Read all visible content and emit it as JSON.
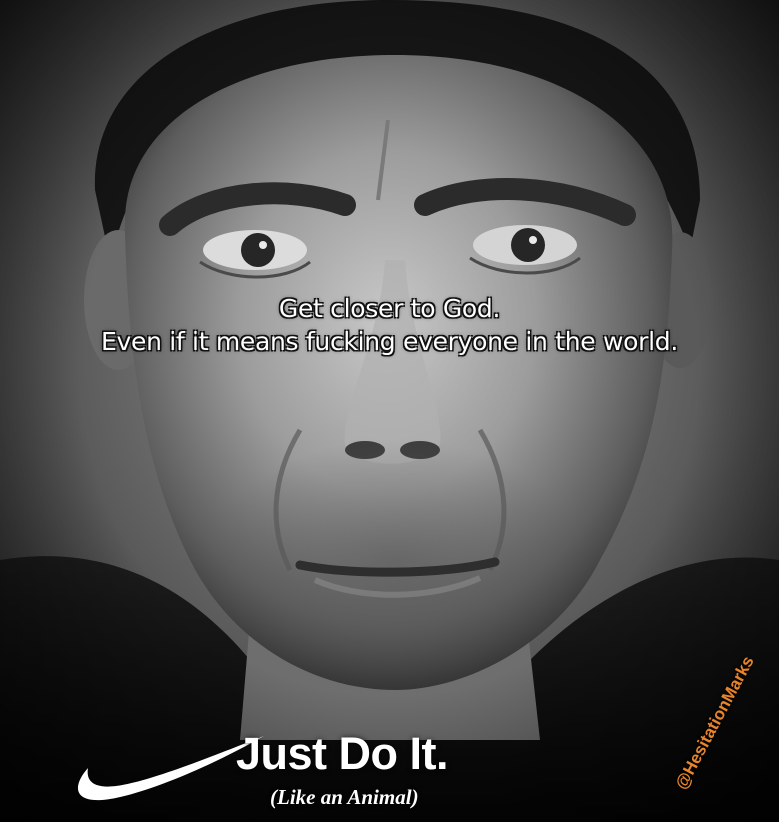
{
  "caption": {
    "line1": "Get closer to God.",
    "line2": "Even if it means fucking everyone in the world."
  },
  "brand": {
    "logo_icon": "swoosh-icon",
    "slogan": "Just Do It.",
    "subslogan": "(Like an Animal)"
  },
  "watermark": {
    "handle": "@HesitationMarks",
    "color": "#e8852a"
  },
  "photo": {
    "description_icon": "bw-portrait-face",
    "palette": [
      "#0b0b0b",
      "#3a3a3a",
      "#8a8a8a",
      "#d9d9d9"
    ]
  }
}
